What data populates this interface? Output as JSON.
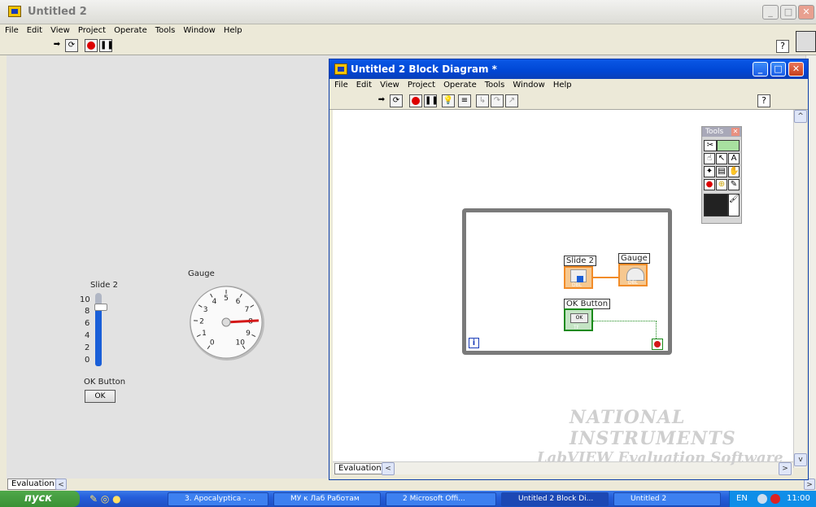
{
  "main_window": {
    "title": "Untitled 2",
    "menu": [
      "File",
      "Edit",
      "View",
      "Project",
      "Operate",
      "Tools",
      "Window",
      "Help"
    ],
    "help_label": "?"
  },
  "front_panel": {
    "slide": {
      "label": "Slide 2",
      "ticks": [
        "10",
        "8",
        "6",
        "4",
        "2",
        "0"
      ],
      "value": 8
    },
    "gauge": {
      "label": "Gauge",
      "ticks": [
        "0",
        "1",
        "2",
        "3",
        "4",
        "5",
        "6",
        "7",
        "8",
        "9",
        "10"
      ],
      "value": 8
    },
    "ok_button": {
      "label": "OK Button",
      "text": "OK"
    },
    "tab_label": "Evaluation"
  },
  "block_diagram": {
    "title": "Untitled 2 Block Diagram *",
    "menu": [
      "File",
      "Edit",
      "View",
      "Project",
      "Operate",
      "Tools",
      "Window",
      "Help"
    ],
    "help_label": "?",
    "tab_label": "Evaluation",
    "nodes": {
      "slide": "Slide 2",
      "gauge": "Gauge",
      "ok": "OK Button",
      "ok_text": "OK",
      "tf": "TF",
      "dbl": "DBL"
    },
    "loop_index": "i"
  },
  "tools_palette": {
    "title": "Tools"
  },
  "watermark": {
    "line1": "NATIONAL",
    "line2": "INSTRUMENTS",
    "line3": "LabVIEW Evaluation Software"
  },
  "taskbar": {
    "start": "пуск",
    "tasks": [
      "3. Apocalyptica - ...",
      "МУ к Лаб Работам",
      "2 Microsoft Offi...",
      "Untitled 2 Block Di...",
      "Untitled 2"
    ],
    "lang": "EN",
    "clock": "11:00"
  }
}
